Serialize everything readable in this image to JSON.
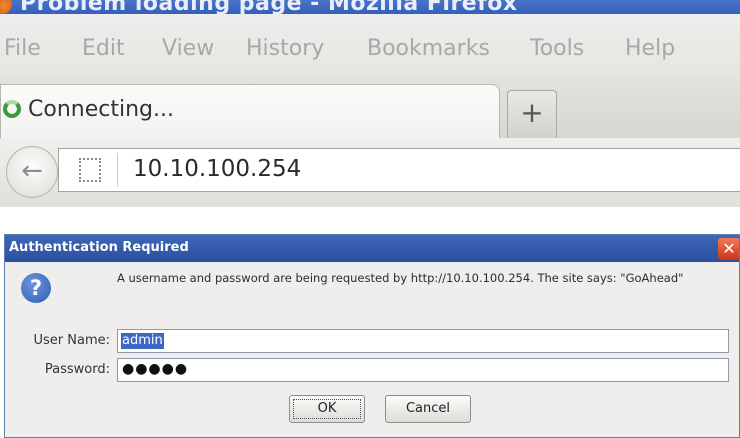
{
  "window": {
    "title": "Problem loading page - Mozilla Firefox"
  },
  "menubar": {
    "items": [
      "File",
      "Edit",
      "View",
      "History",
      "Bookmarks",
      "Tools",
      "Help"
    ]
  },
  "tab": {
    "label": "Connecting...",
    "new_tab_glyph": "+"
  },
  "navbar": {
    "back_glyph": "←",
    "url": "10.10.100.254"
  },
  "dialog": {
    "title": "Authentication Required",
    "close_glyph": "✕",
    "icon_glyph": "?",
    "message": "A username and password are being requested by http://10.10.100.254. The site says: \"GoAhead\"",
    "username_label": "User Name:",
    "username_value": "admin",
    "password_label": "Password:",
    "password_mask": "●●●●●",
    "ok_label": "OK",
    "cancel_label": "Cancel"
  },
  "colors": {
    "titlebar": "#3560b8",
    "dialog_title": "#2a4f9f",
    "selection": "#3d67c7",
    "close": "#c9341a"
  },
  "icons": {
    "back": "back-arrow-icon",
    "site": "site-identity-icon",
    "question": "question-icon",
    "loading": "loading-spinner-icon"
  }
}
